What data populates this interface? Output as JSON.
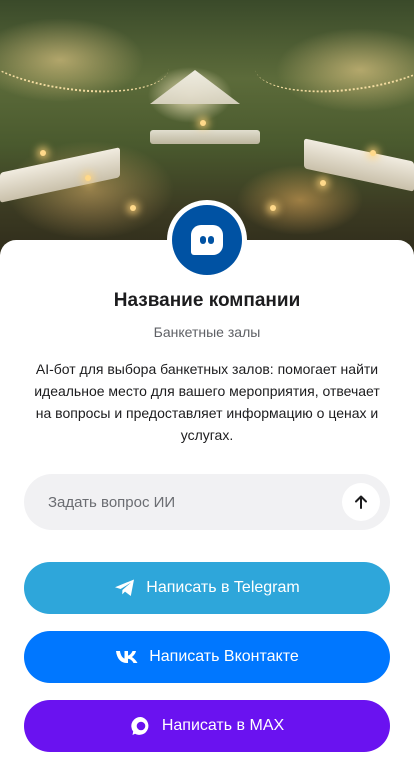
{
  "company": {
    "name": "Название компании",
    "category": "Банкетные залы",
    "description": "AI-бот для выбора банкетных залов: помогает найти идеальное место для вашего мероприятия, отвечает на вопросы и предоставляет информацию о ценах и услугах."
  },
  "avatar": {
    "icon": "chat-bot-icon",
    "color": "#0052a3"
  },
  "ask": {
    "placeholder": "Задать вопрос ИИ",
    "send_icon": "arrow-up-icon"
  },
  "buttons": {
    "telegram": {
      "label": "Написать в Telegram",
      "icon": "telegram-icon",
      "color": "#2ea6da"
    },
    "vk": {
      "label": "Написать Вконтакте",
      "icon": "vk-icon",
      "color": "#0077ff"
    },
    "max": {
      "label": "Написать в MAX",
      "icon": "max-icon",
      "color": "#6a12f0"
    }
  }
}
